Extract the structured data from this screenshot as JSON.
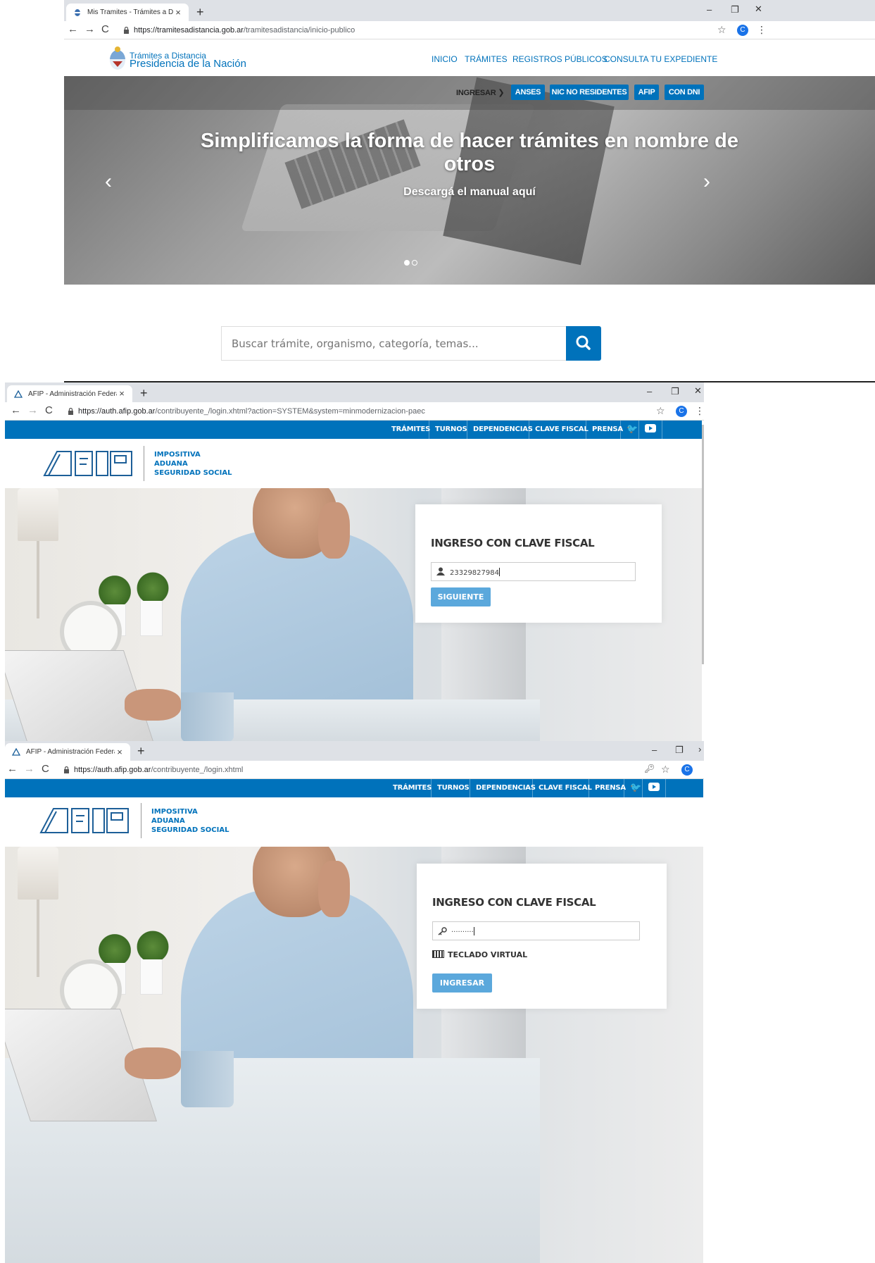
{
  "panel1": {
    "browser": {
      "tab_title": "Mis Tramites - Trámites a Distanc",
      "url_host": "https://tramitesadistancia.gob.ar",
      "url_path": "/tramitesadistancia/inicio-publico",
      "avatar_letter": "C"
    },
    "logo": {
      "line1": "Trámites a Distancia",
      "line2": "Presidencia de la Nación"
    },
    "nav": [
      "INICIO",
      "TRÁMITES",
      "REGISTROS PÚBLICOS",
      "CONSULTA TU EXPEDIENTE"
    ],
    "ingresar_label": "INGRESAR",
    "login_buttons": [
      "ANSES",
      "NIC NO RESIDENTES",
      "AFIP",
      "CON DNI"
    ],
    "hero": {
      "title": "Simplificamos la forma de hacer trámites en nombre de otros",
      "subtitle": "Descargá el manual aquí",
      "active_slide": 1,
      "slide_count": 2
    },
    "search": {
      "placeholder": "Buscar trámite, organismo, categoría, temas..."
    }
  },
  "panel2": {
    "browser": {
      "tab_title": "AFIP - Administración Federal",
      "url_host": "https://auth.afip.gob.ar",
      "url_path": "/contribuyente_/login.xhtml?action=SYSTEM&system=minmodernizacion-paec",
      "avatar_letter": "C"
    },
    "topnav": [
      "TRÁMITES",
      "TURNOS",
      "DEPENDENCIAS",
      "CLAVE FISCAL",
      "PRENSA"
    ],
    "logo_subtitle": [
      "IMPOSITIVA",
      "ADUANA",
      "SEGURIDAD SOCIAL"
    ],
    "login": {
      "title": "INGRESO CON CLAVE FISCAL",
      "cuit_value": "23329827984",
      "button": "SIGUIENTE"
    }
  },
  "panel3": {
    "browser": {
      "tab_title": "AFIP - Administración Federal",
      "url_host": "https://auth.afip.gob.ar",
      "url_path": "/contribuyente_/login.xhtml",
      "avatar_letter": "C"
    },
    "topnav": [
      "TRÁMITES",
      "TURNOS",
      "DEPENDENCIAS",
      "CLAVE FISCAL",
      "PRENSA"
    ],
    "logo_subtitle": [
      "IMPOSITIVA",
      "ADUANA",
      "SEGURIDAD SOCIAL"
    ],
    "login": {
      "title": "INGRESO CON CLAVE FISCAL",
      "password_mask": "··········",
      "teclado": "TECLADO VIRTUAL",
      "button": "INGRESAR"
    }
  },
  "colors": {
    "brand_blue": "#0072bb",
    "afip_button": "#5ba8dc",
    "chrome_bg": "#dee1e6"
  }
}
